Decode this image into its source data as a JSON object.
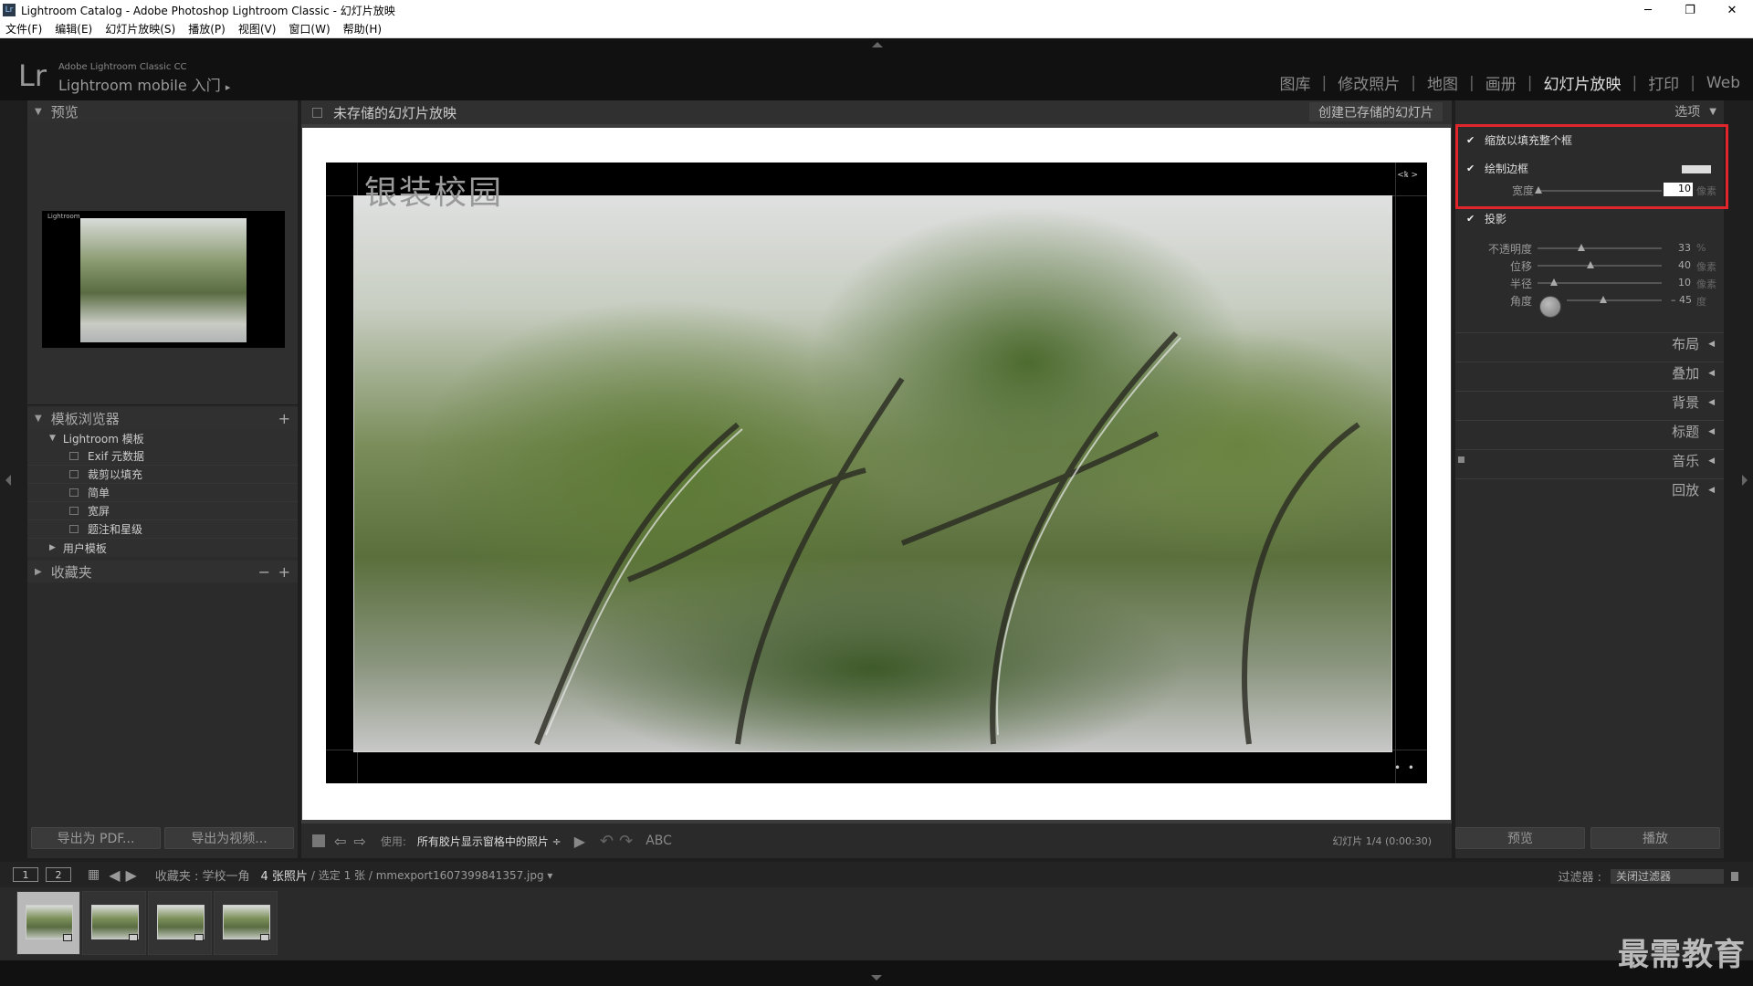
{
  "window": {
    "title": "Lightroom Catalog - Adobe Photoshop Lightroom Classic - 幻灯片放映",
    "icon": "Lr"
  },
  "menu": [
    "文件(F)",
    "编辑(E)",
    "幻灯片放映(S)",
    "播放(P)",
    "视图(V)",
    "窗口(W)",
    "帮助(H)"
  ],
  "identity": {
    "logo": "Lr",
    "line1": "Adobe Lightroom Classic CC",
    "line2": "Lightroom mobile 入门",
    "arrow": "▸"
  },
  "modules": [
    "图库",
    "修改照片",
    "地图",
    "画册",
    "幻灯片放映",
    "打印",
    "Web"
  ],
  "active_module": "幻灯片放映",
  "left_panel": {
    "preview_header": "预览",
    "preview_mini_label": "Lightroom",
    "template_browser_header": "模板浏览器",
    "template_folder": "Lightroom 模板",
    "templates": [
      "Exif 元数据",
      "裁剪以填充",
      "简单",
      "宽屏",
      "题注和星级"
    ],
    "user_templates": "用户模板",
    "collections_header": "收藏夹",
    "export_pdf": "导出为 PDF...",
    "export_video": "导出为视频..."
  },
  "center": {
    "slideshow_title": "未存储的幻灯片放映",
    "create_saved": "创建已存储的幻灯片",
    "photo_title": "银装校园",
    "frame_tag": "<ꝅ >",
    "frame_dots": "• •",
    "toolbar": {
      "use_label": "使用:",
      "use_value": "所有胶片显示窗格中的照片 ÷",
      "abc": "ABC",
      "slide_info": "幻灯片 1/4 (0:00:30)"
    }
  },
  "right_panel": {
    "options_header": "选项",
    "zoom_fill": "缩放以填充整个框",
    "stroke_border": "绘制边框",
    "width_label": "宽度",
    "width_value": "10",
    "width_unit": "像素",
    "shadow": "投影",
    "opacity_label": "不透明度",
    "opacity_value": "33",
    "opacity_unit": "%",
    "offset_label": "位移",
    "offset_value": "40",
    "offset_unit": "像素",
    "radius_label": "半径",
    "radius_value": "10",
    "radius_unit": "像素",
    "angle_label": "角度",
    "angle_value": "– 45",
    "angle_unit": "度",
    "sections": [
      "布局",
      "叠加",
      "背景",
      "标题",
      "音乐",
      "回放"
    ],
    "preview_btn": "预览",
    "play_btn": "播放"
  },
  "filmbar": {
    "screen1": "1",
    "screen2": "2",
    "source": "收藏夹 : 学校一角",
    "count": "4 张照片",
    "selection": "/ 选定 1 张 / mmexport1607399841357.jpg ▾",
    "filter_label": "过滤器 :",
    "filter_value": "关闭过滤器"
  },
  "watermark": "最需教育",
  "colors": {
    "highlight_box": "#e0262a",
    "panel_bg": "#2b2b2b",
    "slide_bg": "#ffffff"
  }
}
